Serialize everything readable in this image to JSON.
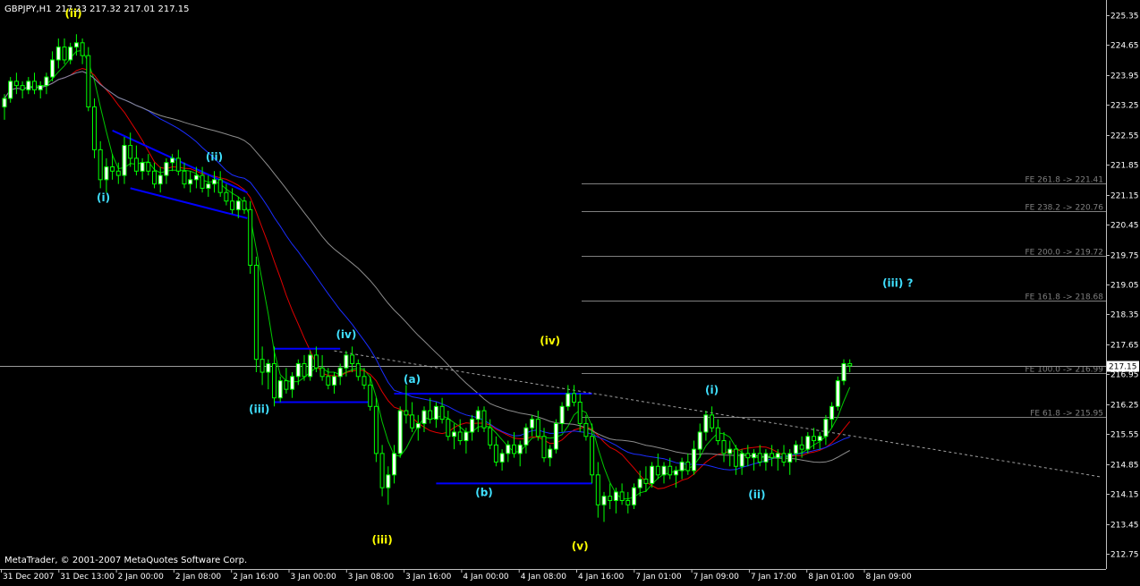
{
  "header": {
    "symbol_tf": "GBPJPY,H1",
    "ohlc": "217.23 217.32 217.01 217.15"
  },
  "copyright": "MetaTrader, © 2001-2007 MetaQuotes Software Corp.",
  "current_price_label": "217.15",
  "colors": {
    "background": "#000000",
    "frame": "#c0c0c0",
    "bull_candle": "#ffffff",
    "bear_candle": "#000000",
    "wick": "#00ff00",
    "ma_fast": "#00c800",
    "ma_mid": "#e00000",
    "ma_slow": "#1a2dff",
    "ma_slowest": "#8c8c8c",
    "channel": "#0000ff",
    "fib": "#7f7f7f",
    "label_cyan": "#40e0ff",
    "label_yellow": "#ffff00"
  },
  "chart_data": {
    "type": "candlestick",
    "symbol": "GBPJPY",
    "timeframe": "H1",
    "ylim": [
      212.4,
      225.7
    ],
    "y_ticks": [
      "225.35",
      "224.65",
      "223.95",
      "223.25",
      "222.55",
      "221.85",
      "221.15",
      "220.45",
      "219.75",
      "219.05",
      "218.35",
      "217.65",
      "216.95",
      "216.25",
      "215.55",
      "214.85",
      "214.15",
      "213.45",
      "212.75"
    ],
    "x_ticks": [
      "31 Dec 2007",
      "31 Dec 13:00",
      "2 Jan 00:00",
      "2 Jan 08:00",
      "2 Jan 16:00",
      "3 Jan 00:00",
      "3 Jan 08:00",
      "3 Jan 16:00",
      "4 Jan 00:00",
      "4 Jan 08:00",
      "4 Jan 16:00",
      "7 Jan 01:00",
      "7 Jan 09:00",
      "7 Jan 17:00",
      "8 Jan 01:00",
      "8 Jan 09:00"
    ],
    "fibonacci_levels": [
      {
        "label": "FE 261.8 -> 221.41",
        "value": 221.41
      },
      {
        "label": "FE 238.2 -> 220.76",
        "value": 220.76
      },
      {
        "label": "FE 200.0 -> 219.72",
        "value": 219.72
      },
      {
        "label": "FE 161.8 -> 218.68",
        "value": 218.68
      },
      {
        "label": "FE 100.0 -> 216.99",
        "value": 216.99
      },
      {
        "label": "FE 61.8 -> 215.95",
        "value": 215.95
      }
    ],
    "wave_labels_cyan": [
      "(i)",
      "(ii)",
      "(iv)",
      "(iii)",
      "(a)",
      "(b)",
      "(i)",
      "(ii)",
      "(iii) ?"
    ],
    "wave_labels_yellow": [
      "(ii)",
      "(iii)",
      "(iv)",
      "(v)"
    ],
    "ohlc": [
      [
        223.2,
        223.5,
        222.9,
        223.4
      ],
      [
        223.4,
        223.9,
        223.3,
        223.8
      ],
      [
        223.8,
        224.0,
        223.5,
        223.7
      ],
      [
        223.7,
        223.8,
        223.4,
        223.6
      ],
      [
        223.6,
        223.9,
        223.5,
        223.8
      ],
      [
        223.8,
        224.0,
        223.5,
        223.6
      ],
      [
        223.6,
        223.8,
        223.4,
        223.7
      ],
      [
        223.7,
        224.0,
        223.5,
        223.9
      ],
      [
        223.9,
        224.5,
        223.8,
        224.3
      ],
      [
        224.3,
        224.8,
        224.1,
        224.6
      ],
      [
        224.6,
        224.8,
        224.2,
        224.3
      ],
      [
        224.3,
        224.7,
        224.2,
        224.6
      ],
      [
        224.6,
        224.9,
        224.4,
        224.7
      ],
      [
        224.7,
        224.8,
        224.2,
        224.4
      ],
      [
        224.4,
        224.6,
        223.1,
        223.2
      ],
      [
        223.2,
        223.4,
        222.0,
        222.2
      ],
      [
        222.2,
        222.4,
        221.3,
        221.5
      ],
      [
        221.5,
        222.0,
        221.2,
        221.8
      ],
      [
        221.8,
        222.1,
        221.5,
        221.7
      ],
      [
        221.7,
        221.9,
        221.4,
        221.6
      ],
      [
        221.6,
        222.5,
        221.4,
        222.3
      ],
      [
        222.3,
        222.6,
        221.8,
        222.0
      ],
      [
        222.0,
        222.3,
        221.6,
        221.7
      ],
      [
        221.7,
        222.0,
        221.5,
        221.9
      ],
      [
        221.9,
        222.1,
        221.6,
        221.7
      ],
      [
        221.7,
        221.9,
        221.3,
        221.4
      ],
      [
        221.4,
        221.8,
        221.2,
        221.6
      ],
      [
        221.6,
        222.0,
        221.4,
        221.9
      ],
      [
        221.9,
        222.1,
        221.7,
        222.0
      ],
      [
        222.0,
        222.2,
        221.6,
        221.7
      ],
      [
        221.7,
        221.9,
        221.3,
        221.4
      ],
      [
        221.4,
        221.7,
        221.2,
        221.5
      ],
      [
        221.5,
        221.8,
        221.3,
        221.6
      ],
      [
        221.6,
        221.8,
        221.2,
        221.3
      ],
      [
        221.3,
        221.6,
        221.1,
        221.4
      ],
      [
        221.4,
        221.7,
        221.2,
        221.5
      ],
      [
        221.5,
        221.7,
        221.1,
        221.2
      ],
      [
        221.2,
        221.4,
        220.9,
        221.0
      ],
      [
        221.0,
        221.3,
        220.7,
        220.8
      ],
      [
        220.8,
        221.1,
        220.6,
        221.0
      ],
      [
        221.0,
        221.1,
        220.7,
        220.8
      ],
      [
        220.8,
        221.0,
        219.3,
        219.5
      ],
      [
        219.5,
        219.7,
        217.0,
        217.3
      ],
      [
        217.3,
        217.6,
        216.7,
        217.0
      ],
      [
        217.0,
        217.3,
        216.6,
        217.2
      ],
      [
        217.2,
        217.6,
        216.2,
        216.4
      ],
      [
        216.4,
        216.9,
        216.3,
        216.8
      ],
      [
        216.8,
        217.1,
        216.5,
        216.6
      ],
      [
        216.6,
        217.0,
        216.4,
        216.9
      ],
      [
        216.9,
        217.3,
        216.7,
        217.2
      ],
      [
        217.2,
        217.4,
        216.8,
        216.9
      ],
      [
        216.9,
        217.5,
        216.8,
        217.4
      ],
      [
        217.4,
        217.6,
        217.0,
        217.1
      ],
      [
        217.1,
        217.4,
        216.8,
        216.9
      ],
      [
        216.9,
        217.1,
        216.6,
        216.7
      ],
      [
        216.7,
        217.0,
        216.5,
        216.9
      ],
      [
        216.9,
        217.2,
        216.7,
        217.1
      ],
      [
        217.1,
        217.5,
        216.9,
        217.4
      ],
      [
        217.4,
        217.6,
        217.0,
        217.2
      ],
      [
        217.2,
        217.3,
        216.8,
        216.9
      ],
      [
        216.9,
        217.1,
        216.6,
        216.7
      ],
      [
        216.7,
        216.9,
        216.1,
        216.2
      ],
      [
        216.2,
        216.4,
        214.9,
        215.1
      ],
      [
        215.1,
        215.3,
        214.1,
        214.3
      ],
      [
        214.3,
        214.8,
        213.9,
        214.6
      ],
      [
        214.6,
        215.3,
        214.4,
        215.1
      ],
      [
        215.1,
        216.2,
        215.0,
        216.1
      ],
      [
        216.1,
        216.7,
        215.8,
        216.0
      ],
      [
        216.0,
        216.3,
        215.6,
        215.7
      ],
      [
        215.7,
        216.0,
        215.4,
        215.8
      ],
      [
        215.8,
        216.2,
        215.6,
        216.1
      ],
      [
        216.1,
        216.4,
        215.8,
        215.9
      ],
      [
        215.9,
        216.3,
        215.7,
        216.2
      ],
      [
        216.2,
        216.4,
        215.8,
        215.9
      ],
      [
        215.9,
        216.1,
        215.4,
        215.5
      ],
      [
        215.5,
        215.8,
        215.2,
        215.6
      ],
      [
        215.6,
        215.9,
        215.3,
        215.4
      ],
      [
        215.4,
        215.7,
        215.1,
        215.6
      ],
      [
        215.6,
        216.0,
        215.4,
        215.9
      ],
      [
        215.9,
        216.2,
        215.6,
        216.1
      ],
      [
        216.1,
        216.2,
        215.6,
        215.7
      ],
      [
        215.7,
        215.9,
        215.2,
        215.3
      ],
      [
        215.3,
        215.5,
        214.8,
        214.9
      ],
      [
        214.9,
        215.2,
        214.7,
        215.1
      ],
      [
        215.1,
        215.4,
        214.9,
        215.3
      ],
      [
        215.3,
        215.6,
        215.0,
        215.1
      ],
      [
        215.1,
        215.4,
        214.8,
        215.3
      ],
      [
        215.3,
        215.8,
        215.1,
        215.7
      ],
      [
        215.7,
        216.0,
        215.5,
        215.9
      ],
      [
        215.9,
        216.1,
        215.4,
        215.5
      ],
      [
        215.5,
        215.7,
        214.9,
        215.0
      ],
      [
        215.0,
        215.3,
        214.8,
        215.2
      ],
      [
        215.2,
        215.9,
        215.1,
        215.8
      ],
      [
        215.8,
        216.3,
        215.6,
        216.2
      ],
      [
        216.2,
        216.7,
        216.1,
        216.5
      ],
      [
        216.5,
        216.7,
        216.2,
        216.3
      ],
      [
        216.3,
        216.5,
        215.6,
        215.8
      ],
      [
        215.8,
        216.0,
        215.4,
        215.5
      ],
      [
        215.5,
        215.8,
        214.4,
        214.6
      ],
      [
        214.6,
        214.9,
        213.6,
        213.9
      ],
      [
        213.9,
        214.2,
        213.5,
        214.1
      ],
      [
        214.1,
        214.4,
        213.8,
        214.0
      ],
      [
        214.0,
        214.3,
        213.7,
        214.2
      ],
      [
        214.2,
        214.4,
        213.9,
        214.0
      ],
      [
        214.0,
        214.2,
        213.7,
        213.9
      ],
      [
        213.9,
        214.4,
        213.8,
        214.3
      ],
      [
        214.3,
        214.7,
        214.1,
        214.5
      ],
      [
        214.5,
        214.8,
        214.2,
        214.4
      ],
      [
        214.4,
        214.9,
        214.3,
        214.8
      ],
      [
        214.8,
        215.1,
        214.5,
        214.6
      ],
      [
        214.6,
        214.9,
        214.4,
        214.8
      ],
      [
        214.8,
        215.0,
        214.5,
        214.6
      ],
      [
        214.6,
        214.8,
        214.3,
        214.7
      ],
      [
        214.7,
        215.0,
        214.5,
        214.9
      ],
      [
        214.9,
        215.1,
        214.6,
        214.7
      ],
      [
        214.7,
        215.4,
        214.6,
        215.2
      ],
      [
        215.2,
        215.8,
        215.0,
        215.6
      ],
      [
        215.6,
        216.1,
        215.4,
        216.0
      ],
      [
        216.0,
        216.2,
        215.6,
        215.7
      ],
      [
        215.7,
        215.9,
        215.3,
        215.4
      ],
      [
        215.4,
        215.6,
        214.9,
        215.1
      ],
      [
        215.1,
        215.4,
        214.8,
        215.2
      ],
      [
        215.2,
        215.3,
        214.6,
        214.8
      ],
      [
        214.8,
        215.2,
        214.6,
        215.1
      ],
      [
        215.1,
        215.3,
        214.8,
        215.0
      ],
      [
        215.0,
        215.2,
        214.7,
        215.1
      ],
      [
        215.1,
        215.3,
        214.8,
        214.9
      ],
      [
        214.9,
        215.2,
        214.7,
        215.1
      ],
      [
        215.1,
        215.3,
        214.8,
        215.0
      ],
      [
        215.0,
        215.2,
        214.7,
        215.1
      ],
      [
        215.1,
        215.3,
        214.8,
        214.9
      ],
      [
        214.9,
        215.2,
        214.6,
        215.1
      ],
      [
        215.1,
        215.4,
        214.9,
        215.3
      ],
      [
        215.3,
        215.5,
        215.0,
        215.2
      ],
      [
        215.2,
        215.6,
        215.1,
        215.5
      ],
      [
        215.5,
        215.7,
        215.2,
        215.4
      ],
      [
        215.4,
        215.6,
        215.2,
        215.5
      ],
      [
        215.5,
        216.0,
        215.3,
        215.9
      ],
      [
        215.9,
        216.3,
        215.7,
        216.2
      ],
      [
        216.2,
        216.9,
        216.1,
        216.8
      ],
      [
        216.8,
        217.3,
        216.7,
        217.2
      ],
      [
        217.2,
        217.3,
        217.0,
        217.15
      ]
    ]
  }
}
